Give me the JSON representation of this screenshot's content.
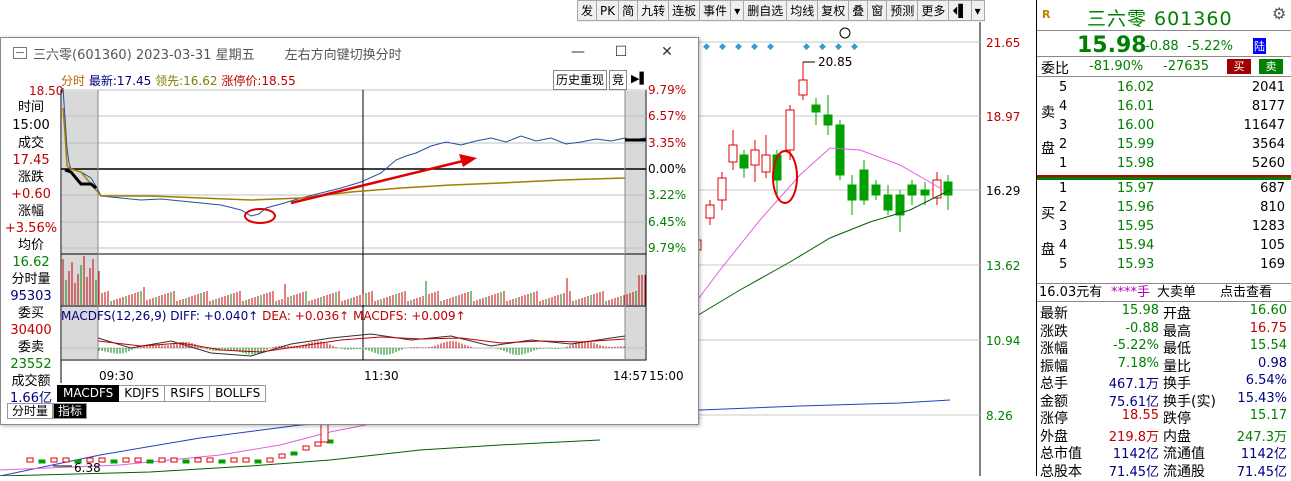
{
  "toolbar": {
    "items": [
      "发",
      "PK",
      "简",
      "九转",
      "连板",
      "事件",
      "▾",
      "删自选",
      "均线",
      "复权",
      "叠",
      "窗",
      "预测",
      "更多",
      "⏴▌",
      "▾"
    ]
  },
  "main_chart": {
    "price_axis": [
      "21.65",
      "18.97",
      "16.29",
      "13.62",
      "10.94",
      "8.26"
    ],
    "max_label": "20.85",
    "min_label": "6.38",
    "colors": {
      "up": "#e00000",
      "down": "#00a000",
      "ma_pink": "#e060e0",
      "ma_green": "#006000",
      "ma_blue": "#2040c0",
      "grid": "#c8c8c8"
    },
    "markers": "◆◆◆◆◆◆◆◆◆"
  },
  "popup": {
    "title": "三六零(601360) 2023-03-31 星期五",
    "hint": "左右方向键切换分时",
    "window_buttons": {
      "min": "—",
      "max": "☐",
      "close": "✕"
    },
    "legend": {
      "prefix": "分时",
      "latest_label": "最新:",
      "latest": "17.45",
      "lead_label": "领先:",
      "lead": "16.62",
      "limit_label": "涨停价:",
      "limit": "18.55"
    },
    "history_button": "历史重现",
    "j_button": "竞",
    "left_axis_top": "18.50",
    "pct_axis": [
      "9.79%",
      "6.57%",
      "3.35%",
      "0.00%",
      "3.22%",
      "6.45%",
      "9.79%"
    ],
    "left_panel": [
      {
        "label": "时间",
        "value": "15:00"
      },
      {
        "label": "成交",
        "value": "17.45"
      },
      {
        "label": "涨跌",
        "value": "+0.60"
      },
      {
        "label": "涨幅",
        "value": "+3.56%"
      },
      {
        "label": "均价",
        "value": "16.62"
      },
      {
        "label": "分时量",
        "value": "95303"
      },
      {
        "label": "委买",
        "value": "30400"
      },
      {
        "label": "委卖",
        "value": "23552"
      },
      {
        "label": "成交额",
        "value": "1.66亿"
      }
    ],
    "macd_legend": {
      "name": "MACDFS(12,26,9)",
      "diff": "DIFF: +0.040↑",
      "dea": "DEA: +0.036↑",
      "macd": "MACDFS: +0.009↑"
    },
    "time_labels": [
      "09:30",
      "11:30",
      "14:57",
      "15:00"
    ],
    "tabs": [
      "MACDFS",
      "KDJFS",
      "RSIFS",
      "BOLLFS"
    ],
    "bottom_tabs": [
      "分时量",
      "指标"
    ]
  },
  "quote": {
    "code_badge": "R",
    "name": "三六零 601360",
    "price": "15.98",
    "change": "-0.88",
    "percent": "-5.22%",
    "exchange_badge": "陆",
    "weibi_label": "委比",
    "weibi": "-81.90%",
    "weicha": "-27635",
    "buy_btn": "买",
    "sell_btn": "卖",
    "sell_side": "卖盘",
    "buy_side": "买盘",
    "asks": [
      {
        "level": "5",
        "price": "16.02",
        "vol": "2041"
      },
      {
        "level": "4",
        "price": "16.01",
        "vol": "8177"
      },
      {
        "level": "3",
        "price": "16.00",
        "vol": "11647"
      },
      {
        "level": "2",
        "price": "15.99",
        "vol": "3564"
      },
      {
        "level": "1",
        "price": "15.98",
        "vol": "5260"
      }
    ],
    "bids": [
      {
        "level": "1",
        "price": "15.97",
        "vol": "687"
      },
      {
        "level": "2",
        "price": "15.96",
        "vol": "810"
      },
      {
        "level": "3",
        "price": "15.95",
        "vol": "1283"
      },
      {
        "level": "4",
        "price": "15.94",
        "vol": "105"
      },
      {
        "level": "5",
        "price": "15.93",
        "vol": "169"
      }
    ],
    "tape": {
      "price": "16.03元有",
      "stars": "****手",
      "big": "大卖单",
      "check": "点击查看"
    },
    "stats": [
      {
        "l": "最新",
        "v": "15.98",
        "l2": "开盘",
        "v2": "16.60"
      },
      {
        "l": "涨跌",
        "v": "-0.88",
        "l2": "最高",
        "v2": "16.75"
      },
      {
        "l": "涨幅",
        "v": "-5.22%",
        "l2": "最低",
        "v2": "15.54"
      },
      {
        "l": "振幅",
        "v": "7.18%",
        "l2": "量比",
        "v2": "0.98"
      },
      {
        "l": "总手",
        "v": "467.1万",
        "l2": "换手",
        "v2": "6.54%"
      },
      {
        "l": "金额",
        "v": "75.61亿",
        "l2": "换手(实)",
        "v2": "15.43%"
      },
      {
        "l": "涨停",
        "v": "18.55",
        "l2": "跌停",
        "v2": "15.17"
      },
      {
        "l": "外盘",
        "v": "219.8万",
        "l2": "内盘",
        "v2": "247.3万"
      },
      {
        "l": "总市值",
        "v": "1142亿",
        "l2": "流通值",
        "v2": "1142亿"
      },
      {
        "l": "总股本",
        "v": "71.45亿",
        "l2": "流通股",
        "v2": "71.45亿"
      }
    ]
  }
}
